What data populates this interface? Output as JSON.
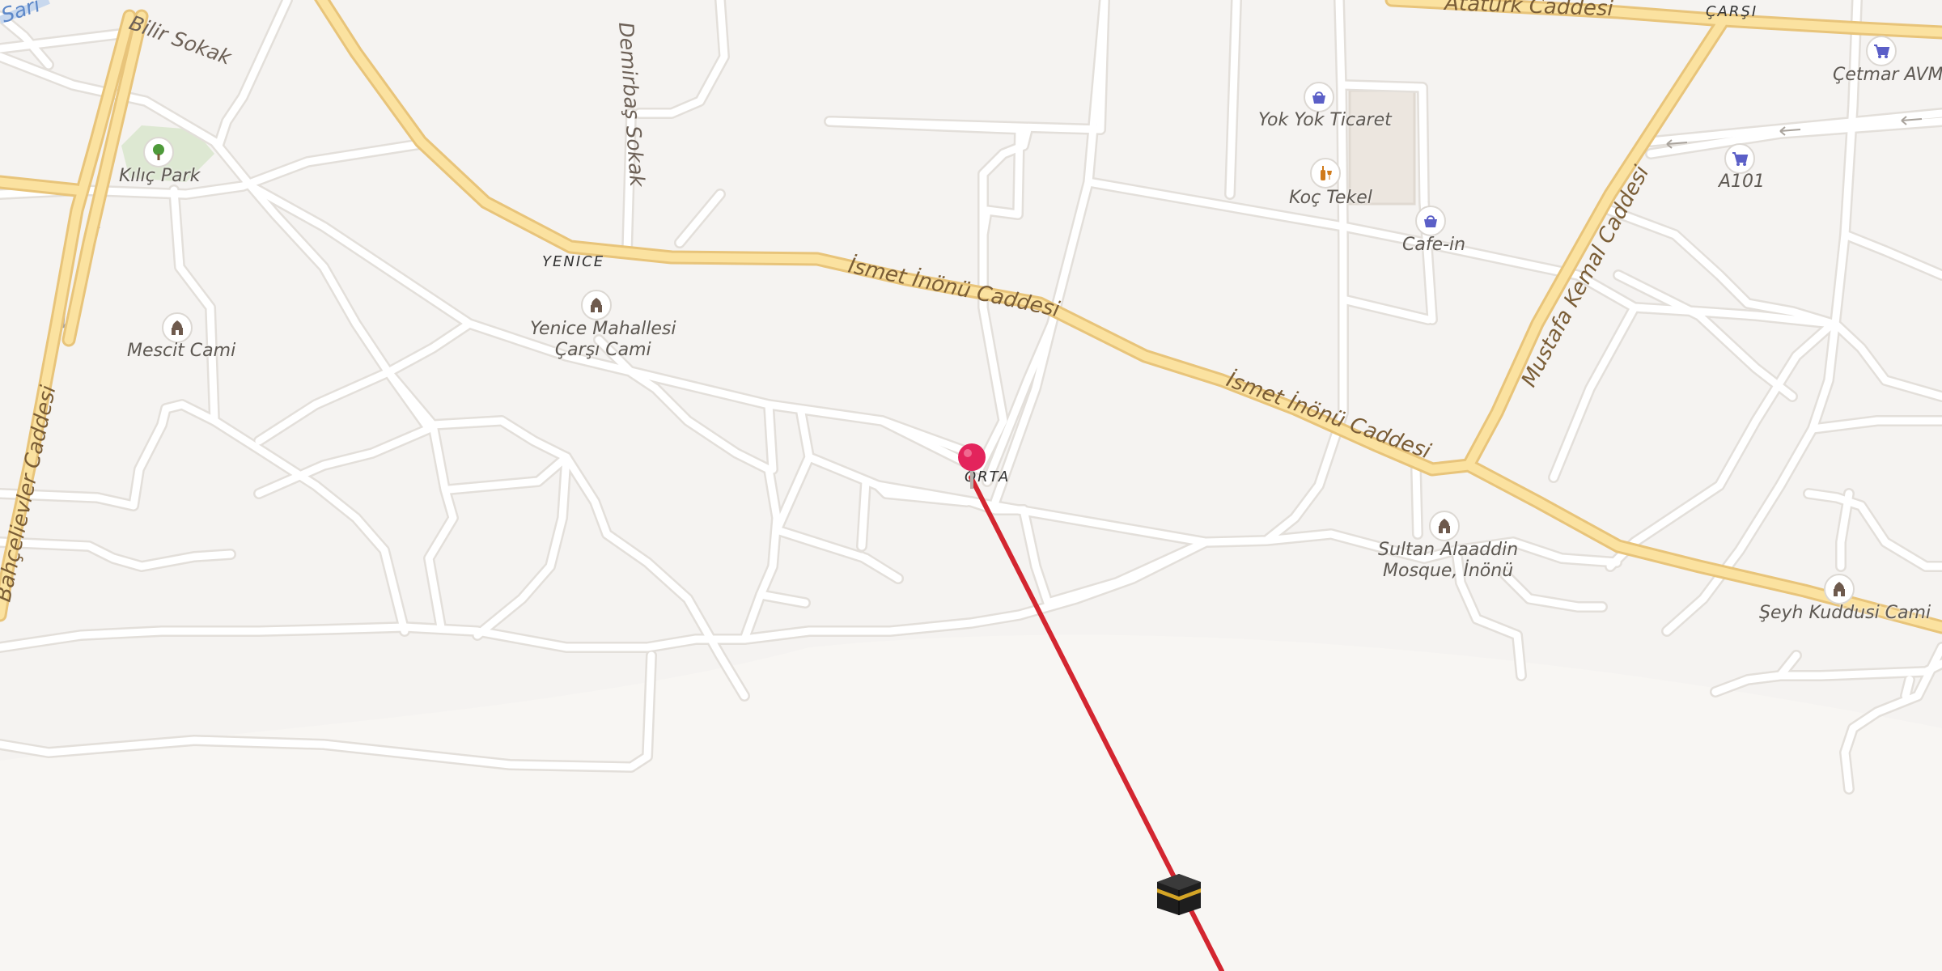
{
  "map": {
    "streets": {
      "bilir": "Bilir Sokak",
      "demirbas": "Demirbaş Sokak",
      "ataturk": "Atatürk Caddesi",
      "ismet1": "İsmet İnönü Caddesi",
      "ismet2": "İsmet İnönü Caddesi",
      "mustafa": "Mustafa Kemal Caddesi",
      "bahcelievler": "Bahçelievler Caddesi",
      "corner": "Sarı"
    },
    "districts": {
      "yenice": "YENICE",
      "orta": "ORTA",
      "carsi": "ÇARŞI"
    },
    "pois": {
      "kilic_park": "Kılıç Park",
      "mescit_cami": "Mescit Cami",
      "yenice_line1": "Yenice Mahallesi",
      "yenice_line2": "Çarşı Cami",
      "yok_yok": "Yok Yok Ticaret",
      "koc_tekel": "Koç Tekel",
      "cafe_in": "Cafe-in",
      "cetmar": "Çetmar AVM",
      "a101": "A101",
      "sultan_line1": "Sultan Alaaddin",
      "sultan_line2": "Mosque, İnönü",
      "seyh": "Şeyh Kuddusi Cami"
    },
    "colors": {
      "background": "#f5f3f1",
      "road": "#ffffff",
      "road_outline": "#e3dfda",
      "main_road": "#fbe2a0",
      "main_road_outline": "#e8c47a",
      "qibla_line": "#d32630",
      "pin": "#e3245c",
      "shop_icon": "#5b5fc7",
      "mosque_icon": "#6e5a4d",
      "park_icon": "#4e9a3a"
    },
    "icons": {
      "pin": "location-pin-icon",
      "kaaba": "kaaba-icon",
      "mosque": "mosque-icon",
      "shop": "shopping-basket-icon",
      "cart": "shopping-cart-icon",
      "park": "tree-icon",
      "liquor": "liquor-store-icon"
    }
  }
}
